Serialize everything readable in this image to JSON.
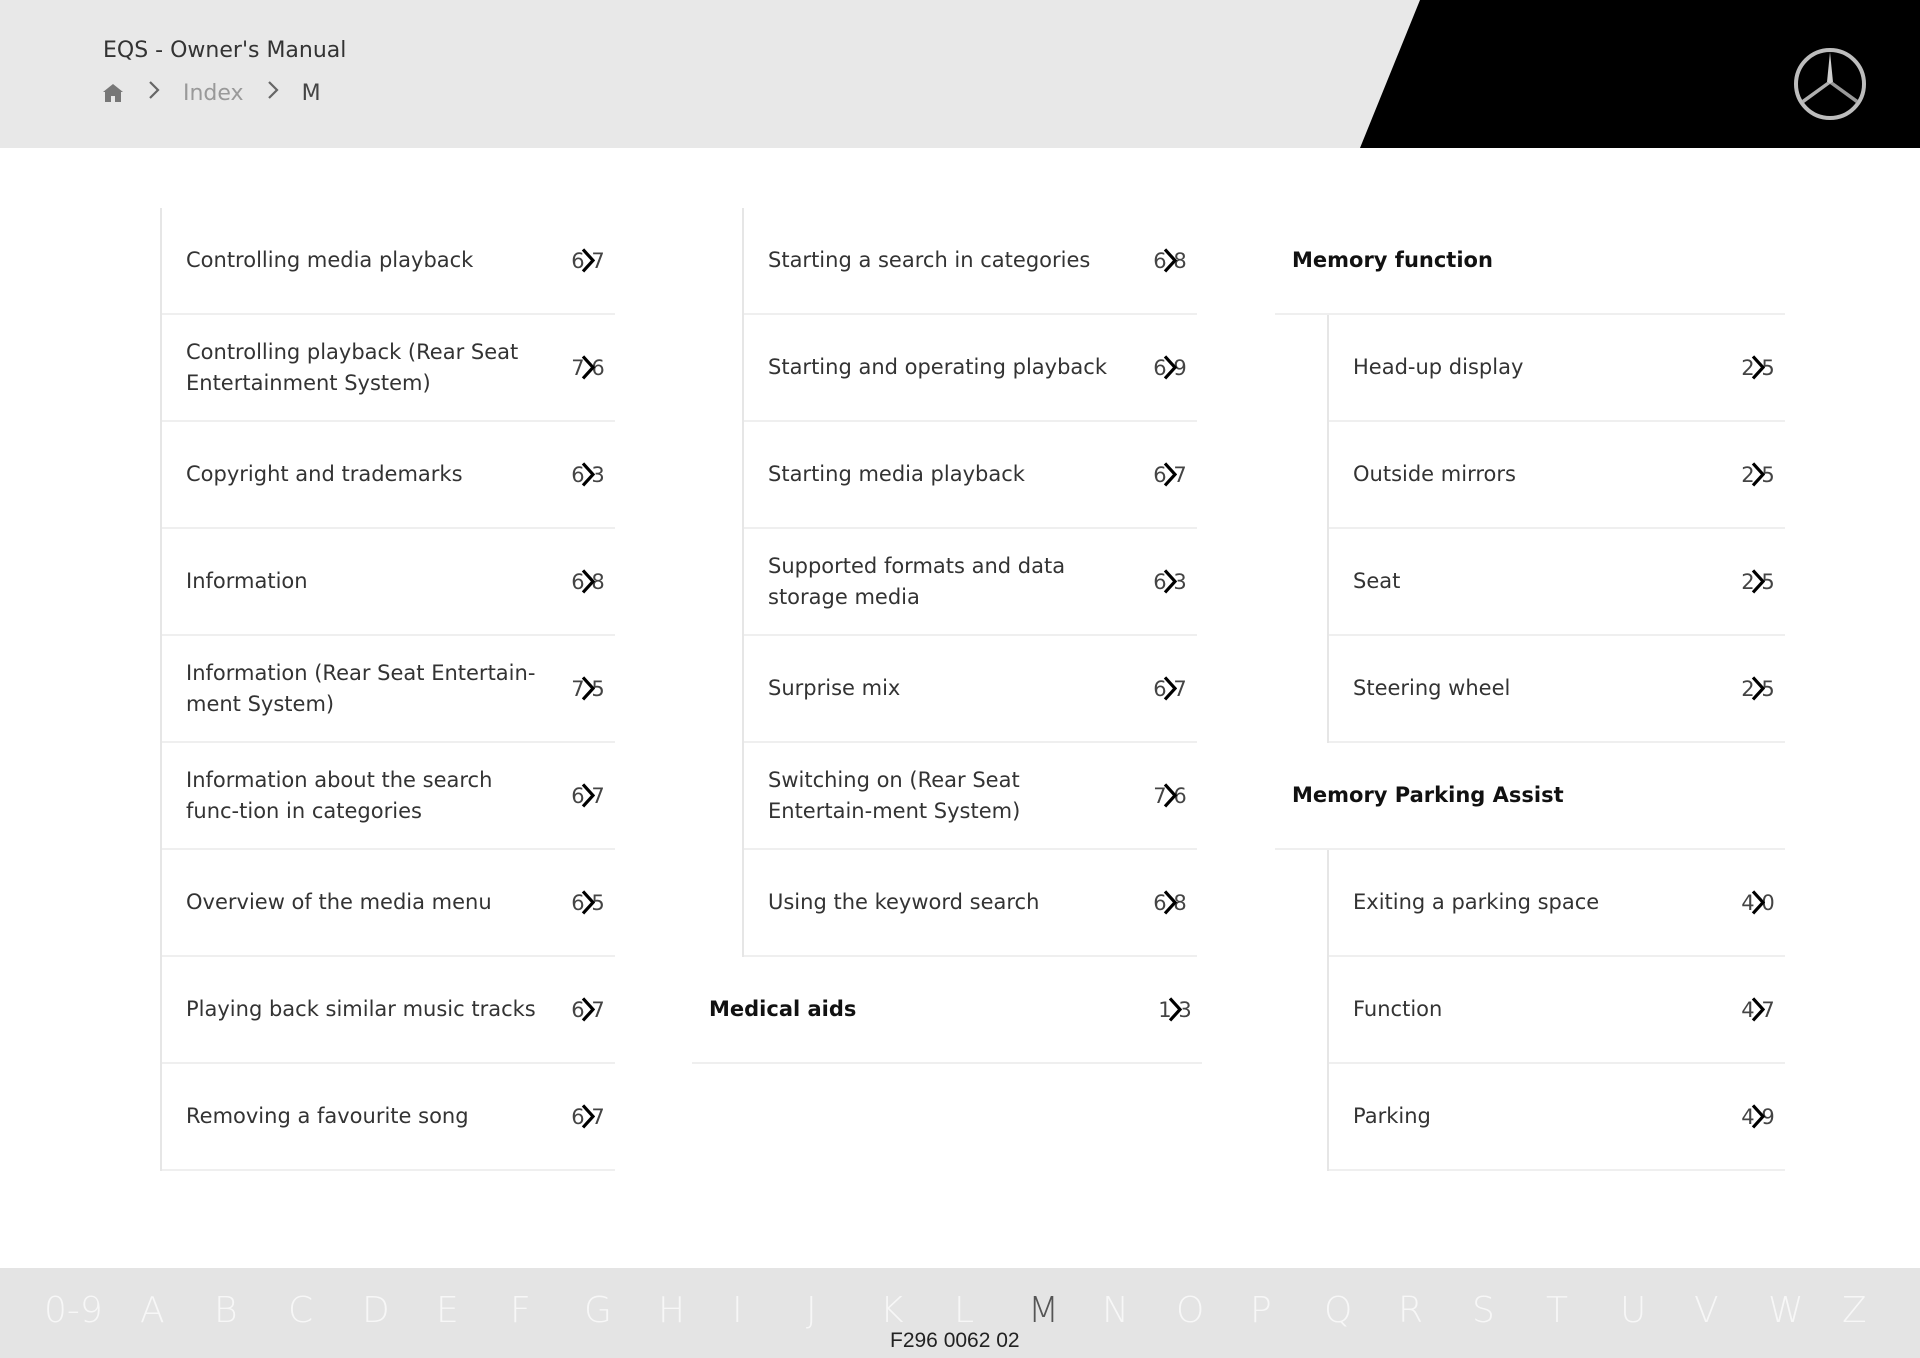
{
  "header": {
    "doc_title": "EQS - Owner's Manual",
    "breadcrumb": {
      "home_icon": "home-icon",
      "separator_icon": "chevron-right-icon",
      "items": [
        "Index",
        "M"
      ]
    },
    "logo": "mercedes-star-logo"
  },
  "columns": [
    {
      "entries": [
        {
          "label": "Controlling media playback",
          "page": "6 7"
        },
        {
          "label": "Controlling playback (Rear Seat Entertainment System)",
          "page": "7 6"
        },
        {
          "label": "Copyright and trademarks",
          "page": "6 3"
        },
        {
          "label": "Information",
          "page": "6 8"
        },
        {
          "label": "Information (Rear Seat Entertain-ment System)",
          "page": "7 5"
        },
        {
          "label": "Information about the search func-tion in categories",
          "page": "6 7"
        },
        {
          "label": "Overview of the media menu",
          "page": "6 5"
        },
        {
          "label": "Playing back similar music tracks",
          "page": "6 7"
        },
        {
          "label": "Removing a favourite song",
          "page": "6 7"
        }
      ]
    },
    {
      "entries": [
        {
          "label": "Starting a search in categories",
          "page": "6 8"
        },
        {
          "label": "Starting and operating playback",
          "page": "6 9"
        },
        {
          "label": "Starting media playback",
          "page": "6 7"
        },
        {
          "label": "Supported formats and data storage media",
          "page": "6 3"
        },
        {
          "label": "Surprise mix",
          "page": "6 7"
        },
        {
          "label": "Switching on (Rear Seat Entertain-ment System)",
          "page": "7 6"
        },
        {
          "label": "Using the keyword search",
          "page": "6 8"
        }
      ],
      "heading": {
        "label": "Medical aids",
        "page": "1 3"
      }
    },
    {
      "groups": [
        {
          "heading": "Memory function",
          "entries": [
            {
              "label": "Head-up display",
              "page": "2 5"
            },
            {
              "label": "Outside mirrors",
              "page": "2 5"
            },
            {
              "label": "Seat",
              "page": "2 5"
            },
            {
              "label": "Steering wheel",
              "page": "2 5"
            }
          ]
        },
        {
          "heading": "Memory Parking Assist",
          "entries": [
            {
              "label": "Exiting a parking space",
              "page": "4 0"
            },
            {
              "label": "Function",
              "page": "4 7"
            },
            {
              "label": "Parking",
              "page": "4 9"
            }
          ]
        }
      ]
    }
  ],
  "alphabet": {
    "letters": [
      "0-9",
      "A",
      "B",
      "C",
      "D",
      "E",
      "F",
      "G",
      "H",
      "I",
      "J",
      "K",
      "L",
      "M",
      "N",
      "O",
      "P",
      "Q",
      "R",
      "S",
      "T",
      "U",
      "V",
      "W",
      "Z"
    ],
    "active": "M"
  },
  "doc_code": "F296 0062 02"
}
